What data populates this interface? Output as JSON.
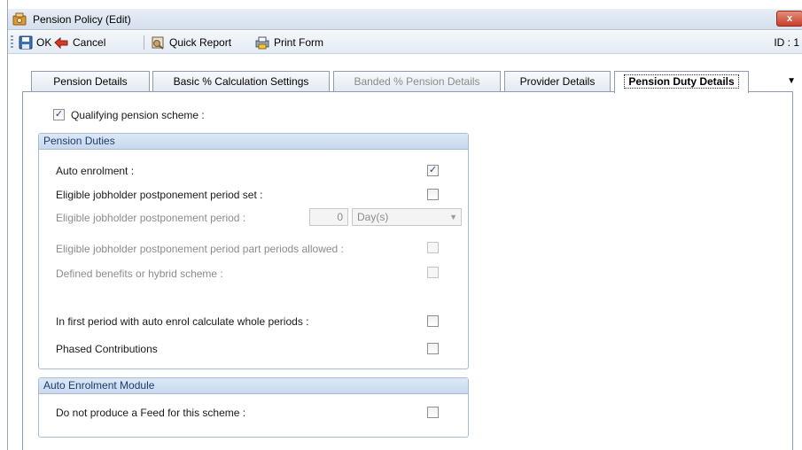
{
  "window": {
    "title": "Pension Policy (Edit)",
    "close_label": "x",
    "id_label": "ID : 1"
  },
  "toolbar": {
    "ok": "OK",
    "cancel": "Cancel",
    "quick_report": "Quick Report",
    "print_form": "Print Form"
  },
  "tabs": [
    {
      "label": "Pension Details",
      "state": "normal"
    },
    {
      "label": "Basic % Calculation Settings",
      "state": "normal"
    },
    {
      "label": "Banded % Pension Details",
      "state": "disabled"
    },
    {
      "label": "Provider Details",
      "state": "normal"
    },
    {
      "label": "Pension Duty Details",
      "state": "active"
    }
  ],
  "qualifying": {
    "label": "Qualifying pension scheme :",
    "checked": true
  },
  "pension_duties": {
    "header": "Pension Duties",
    "auto_enrolment": {
      "label": "Auto enrolment  :",
      "checked": true
    },
    "postponement_set": {
      "label": "Eligible jobholder postponement period set  :",
      "checked": false
    },
    "postponement_period": {
      "label": "Eligible jobholder postponement period :",
      "value": "0",
      "unit": "Day(s)"
    },
    "part_periods": {
      "label": "Eligible jobholder postponement period part periods allowed  :",
      "checked": false
    },
    "defined_benefits": {
      "label": "Defined benefits or hybrid scheme :",
      "checked": false
    },
    "whole_periods": {
      "label": "In first period with auto enrol calculate whole periods :",
      "checked": false
    },
    "phased": {
      "label": "Phased Contributions",
      "checked": false
    }
  },
  "auto_enrolment_module": {
    "header": "Auto Enrolment Module",
    "no_feed": {
      "label": "Do not produce a Feed for this scheme  :",
      "checked": false
    }
  },
  "colors": {
    "accent": "#1f3b6b",
    "group_header": "#c7d8ee",
    "close": "#c8402b"
  }
}
